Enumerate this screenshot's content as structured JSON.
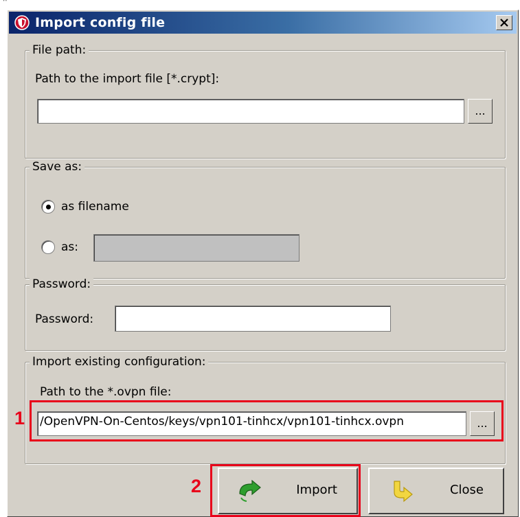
{
  "window": {
    "title": "Import config file",
    "close_symbol": "✕"
  },
  "file_path": {
    "group_label": "File path:",
    "field_label": "Path to the import file [*.crypt]:",
    "value": "",
    "browse_label": "..."
  },
  "save_as": {
    "group_label": "Save as:",
    "option_filename_label": "as filename",
    "option_as_label": "as:",
    "as_value": "",
    "selected": "as filename"
  },
  "password": {
    "group_label": "Password:",
    "field_label": "Password:",
    "value": ""
  },
  "import_existing": {
    "group_label": "Import existing configuration:",
    "field_label": "Path to the *.ovpn file:",
    "value": "/OpenVPN-On-Centos/keys/vpn101-tinhcx/vpn101-tinhcx.ovpn",
    "browse_label": "..."
  },
  "buttons": {
    "import_label": "Import",
    "close_label": "Close"
  },
  "annotations": {
    "step1": "1",
    "step2": "2",
    "color": "#e8001a"
  },
  "icons": {
    "title": "shield-icon",
    "import": "green-arrow-icon",
    "close": "yellow-arrow-icon"
  }
}
